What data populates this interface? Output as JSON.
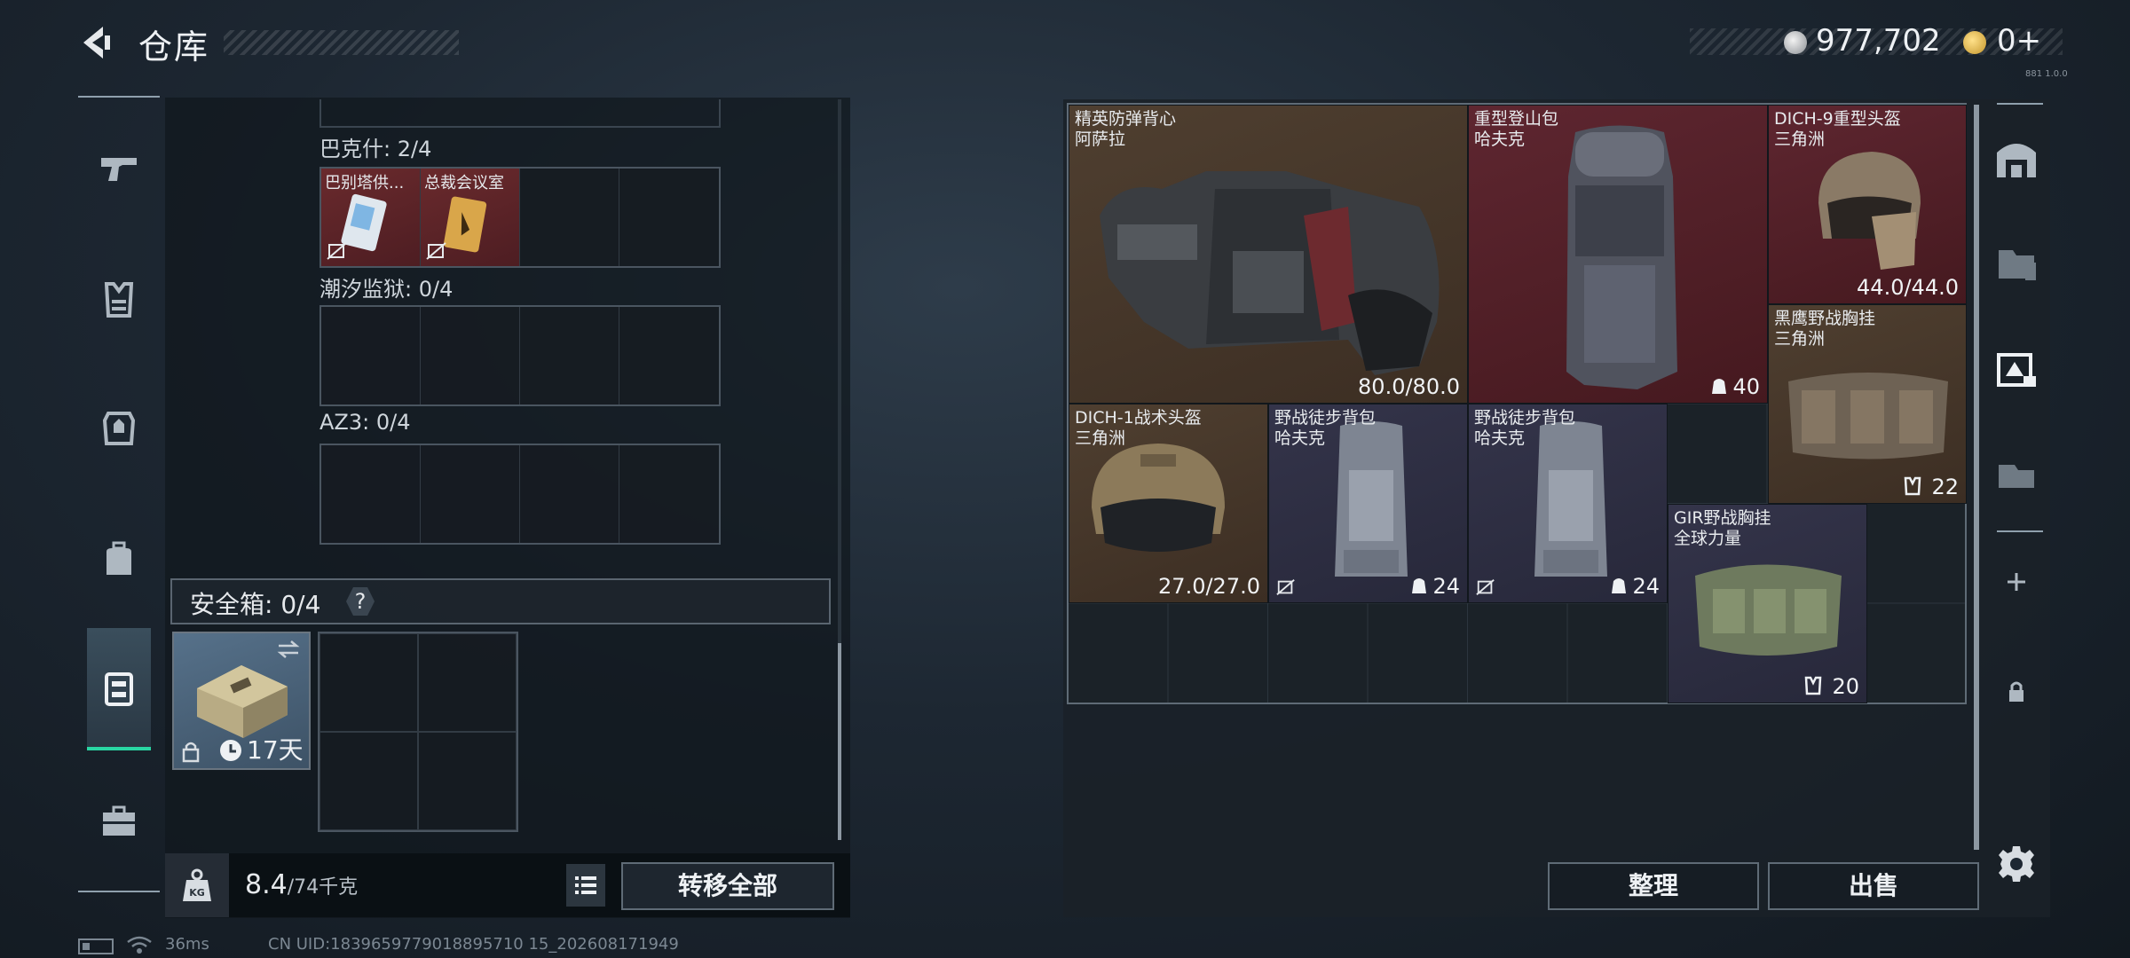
{
  "header": {
    "title": "仓库",
    "currency_silver": "977,702",
    "currency_gold": "0+",
    "corner_note": "881 1.0.0"
  },
  "left_sidebar": {
    "items": [
      {
        "icon": "pistol-icon"
      },
      {
        "icon": "vest-icon"
      },
      {
        "icon": "armor-icon"
      },
      {
        "icon": "backpack-icon"
      },
      {
        "icon": "safe-box-icon",
        "active": true
      },
      {
        "icon": "toolbox-icon"
      }
    ]
  },
  "container": {
    "sections": [
      {
        "label": "巴克什: 2/4",
        "cards": [
          "巴别塔供...",
          "总裁会议室"
        ]
      },
      {
        "label": "潮汐监狱: 0/4",
        "cards": []
      },
      {
        "label": "AZ3: 0/4",
        "cards": []
      }
    ],
    "safe_box": {
      "label": "安全箱: 0/4",
      "help": "?",
      "item_timer": "17天"
    },
    "weight": {
      "current": "8.4",
      "max": "/74千克"
    },
    "transfer_label": "转移全部"
  },
  "stash": {
    "items": [
      {
        "name": "精英防弹背心",
        "sub": "阿萨拉",
        "value": "80.0/80.0"
      },
      {
        "name": "重型登山包",
        "sub": "哈夫克",
        "value": "40"
      },
      {
        "name": "DICH-9重型头盔",
        "sub": "三角洲",
        "value": "44.0/44.0"
      },
      {
        "name": "黑鹰野战胸挂",
        "sub": "三角洲",
        "value": "22"
      },
      {
        "name": "DICH-1战术头盔",
        "sub": "三角洲",
        "value": "27.0/27.0"
      },
      {
        "name": "野战徒步背包",
        "sub": "哈夫克",
        "value": "24"
      },
      {
        "name": "野战徒步背包",
        "sub": "哈夫克",
        "value": "24"
      },
      {
        "name": "GIR野战胸挂",
        "sub": "全球力量",
        "value": "20"
      }
    ],
    "sort_label": "整理",
    "sell_label": "出售"
  },
  "status": {
    "ping": "36ms",
    "uid": "CN UID:1839659779018895710 15_202608171949"
  },
  "colors": {
    "accent": "#29d6a3",
    "rarity_brown": "#4f3f30",
    "rarity_red": "#5e2630",
    "rarity_navy": "#34344a"
  }
}
